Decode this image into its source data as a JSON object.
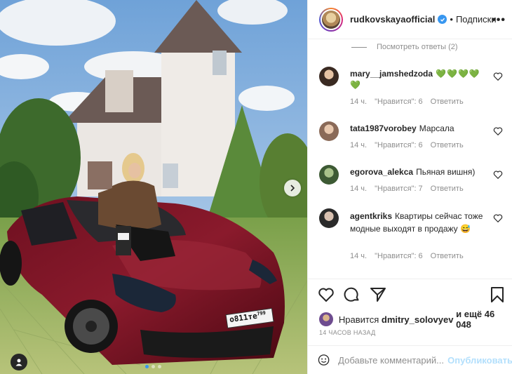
{
  "header": {
    "username": "rudkovskaya​official",
    "separator": "•",
    "follow_label": "Подписки",
    "more_label": "•••"
  },
  "photo": {
    "plate_text": "о811те",
    "plate_region": "799"
  },
  "comments": {
    "view_replies": "Посмотреть ответы (2)",
    "items": [
      {
        "user": "mary__jamshedzoda",
        "text": "💚💚💚💚💚",
        "time": "14 ч.",
        "likes": "\"Нравится\": 6",
        "reply": "Ответить"
      },
      {
        "user": "tata1987vorobey",
        "text": "Марсала",
        "time": "14 ч.",
        "likes": "\"Нравится\": 6",
        "reply": "Ответить"
      },
      {
        "user": "egorova_alekca",
        "text": "Пьяная вишня)",
        "time": "14 ч.",
        "likes": "\"Нравится\": 7",
        "reply": "Ответить"
      },
      {
        "user": "agentkriks",
        "text": "Квартиры сейчас тоже модные выходят в продажу 😅",
        "time": "14 ч.",
        "likes": "\"Нравится\": 6",
        "reply": "Ответить"
      }
    ]
  },
  "likes": {
    "prefix": "Нравится",
    "user": "dmitry_solovyev",
    "and_more": "и ещё 46 048"
  },
  "time_ago": "14 ЧАСОВ НАЗАД",
  "add_comment": {
    "placeholder": "Добавьте комментарий...",
    "publish_label": "Опубликовать"
  },
  "colors": {
    "accent": "#3897f0",
    "publish_disabled": "#b2dffc",
    "like_green": "#2ecc2e"
  },
  "icons": [
    "heart-icon",
    "comment-icon",
    "share-icon",
    "bookmark-icon",
    "emoji-icon",
    "chevron-right-icon",
    "user-tag-icon",
    "verified-icon"
  ]
}
